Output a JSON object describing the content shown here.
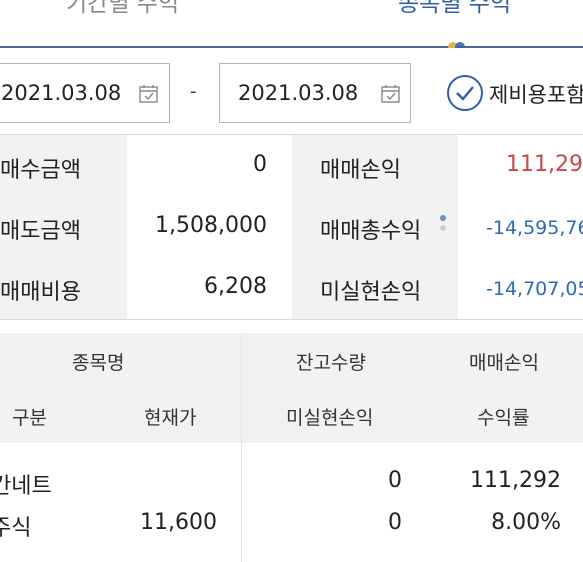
{
  "tabs": [
    {
      "label": "기간별 수익",
      "active": false
    },
    {
      "label": "종목별 수익",
      "active": true
    }
  ],
  "date_filter": {
    "from": "2021.03.08",
    "separator": "-",
    "to": "2021.03.08",
    "include_fee_label": "제비용포함",
    "include_fee_checked": true
  },
  "summary": {
    "buy_amount_label": "매수금액",
    "buy_amount": "0",
    "sell_amount_label": "매도금액",
    "sell_amount": "1,508,000",
    "fee_label": "매매비용",
    "fee": "6,208",
    "trade_pl_label": "매매손익",
    "trade_pl": "111,29",
    "total_return_label": "매매총수익",
    "total_return": "-14,595,76",
    "unrealized_label": "미실현손익",
    "unrealized": "-14,707,05"
  },
  "table": {
    "headers": {
      "name": "종목명",
      "type": "구분",
      "price": "현재가",
      "balance_qty": "잔고수량",
      "unrealized": "미실현손익",
      "trade_pl": "매매손익",
      "return_rate": "수익률"
    },
    "rows": [
      {
        "name": "칸네트",
        "type": "주식",
        "price": "11,600",
        "balance_qty": "0",
        "unrealized": "0",
        "trade_pl": "111,292",
        "return_rate": "8.00%"
      }
    ]
  },
  "colors": {
    "accent": "#2f5fa6",
    "profit": "#c9474d",
    "loss": "#2f6bb0",
    "label_bg": "#f2f2f2"
  }
}
